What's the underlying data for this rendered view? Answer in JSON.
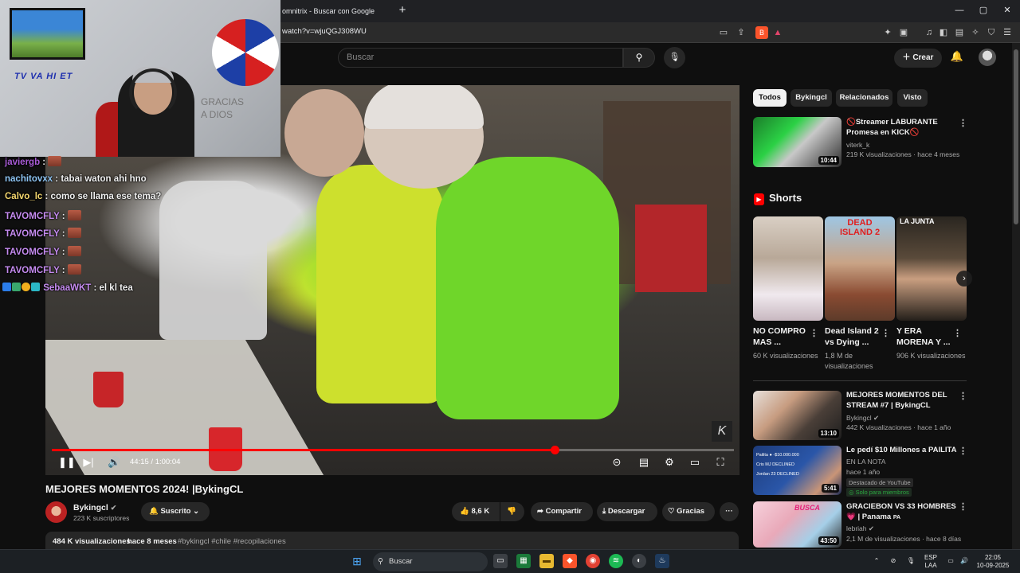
{
  "browser": {
    "tab_title": "omnitrix - Buscar con Google",
    "new_tab": "+",
    "url": "watch?v=wjuQGJ308WU",
    "window_controls": [
      "—",
      "▢",
      "✕"
    ]
  },
  "header": {
    "search_placeholder": "Buscar",
    "search_icon": "search-icon",
    "mic_icon": "mic-icon",
    "create_label": "Crear",
    "create_icon": "plus-icon",
    "bell_icon": "bell-icon"
  },
  "player": {
    "current_time": "44:15 / 1:00:04",
    "progress_fraction": 0.737,
    "watermark": "K",
    "accent_color": "#ff0000"
  },
  "webcam": {
    "banner_text": "TV VA HI ET",
    "sign_text": "GRACIAS A DIOS"
  },
  "chat": [
    {
      "user": "javiergb",
      "color": "#a85bd6",
      "text": "",
      "emote": true
    },
    {
      "user": "nachitovxx",
      "color": "#8fc6f5",
      "text": "tabai waton ahi hno",
      "emote": false
    },
    {
      "user": "Calvo_lc",
      "color": "#f5d76e",
      "text": "como se llama ese tema?",
      "emote": false
    },
    {
      "user": "TAVOMCFLY",
      "color": "#c58bf0",
      "text": "",
      "emote": true
    },
    {
      "user": "TAVOMCFLY",
      "color": "#c58bf0",
      "text": "",
      "emote": true
    },
    {
      "user": "TAVOMCFLY",
      "color": "#c58bf0",
      "text": "",
      "emote": true
    },
    {
      "user": "TAVOMCFLY",
      "color": "#c58bf0",
      "text": "",
      "emote": true
    },
    {
      "user": "SebaaWKT",
      "color": "#c58bf0",
      "text": "el kl tea",
      "emote": false,
      "badges": true
    }
  ],
  "video": {
    "title": "MEJORES MOMENTOS 2024! |BykingCL",
    "channel": "Bykingcl",
    "subscribers": "223 K suscriptores",
    "subscribed_label": "Suscrito",
    "likes": "8,6 K",
    "share_label": "Compartir",
    "download_label": "Descargar",
    "thanks_label": "Gracias",
    "more_label": "···",
    "views": "484 K visualizaciones",
    "date": "hace 8 meses",
    "tags": "#bykingcl #chile #recopilaciones"
  },
  "sidebar": {
    "chips": [
      "Todos",
      "Bykingcl",
      "Relacionados",
      "Visto"
    ],
    "active_chip": 0,
    "top_video": {
      "title": "🚫Streamer LABURANTE Promesa en KICK🚫",
      "channel": "viterk_k",
      "meta": "219 K visualizaciones · hace 4 meses",
      "duration": "10:44"
    },
    "shorts_label": "Shorts",
    "shorts": [
      {
        "title": "NO COMPRO MAS ...",
        "views": "60 K visualizaciones"
      },
      {
        "title": "Dead Island 2 vs Dying ...",
        "views": "1,8 M de visualizaciones"
      },
      {
        "title": "Y ERA MORENA Y ...",
        "views": "906 K visualizaciones"
      }
    ],
    "shorts_thumb_text_2": "DEAD ISLAND 2",
    "shorts_thumb_text_3": "LA JUNTA",
    "videos": [
      {
        "title": "MEJORES MOMENTOS DEL STREAM #7 | BykingCL",
        "channel": "Bykingcl",
        "meta": "442 K visualizaciones · hace 1 año",
        "duration": "13:10"
      },
      {
        "title": "Le pedí $10 Millones a PAILITA",
        "channel": "EN LA NOTA",
        "meta": "hace 1 año",
        "badge_featured": "Destacado de YouTube",
        "badge_members": "Solo para miembros",
        "duration": "5:41",
        "thumb_lines": [
          "Pailita ● -$10.000.000",
          "Cris MJ DECLINED",
          "Jordan 23 DECLINED"
        ]
      },
      {
        "title": "GRACIEBON VS 33 HOMBRES 💗 | Panama",
        "country_code": "PA",
        "channel": "lebriah",
        "meta": "2,1 M de visualizaciones · hace 8 días",
        "duration": "43:50",
        "thumb_text": "BUSCA"
      }
    ]
  },
  "taskbar": {
    "search_label": "Buscar",
    "language": "ESP",
    "language_sub": "LAA",
    "time": "22:05",
    "date": "10-09-2025"
  }
}
